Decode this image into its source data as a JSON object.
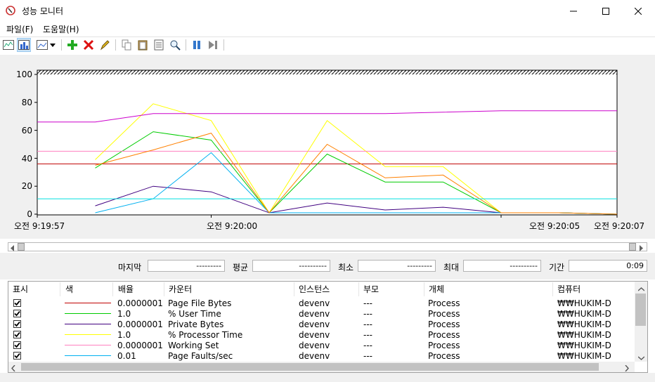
{
  "window": {
    "title": "성능 모니터"
  },
  "menu": [
    "파일(F)",
    "도움말(H)"
  ],
  "toolbar": {
    "icons": [
      "view-graph-icon",
      "view-histogram-icon",
      "view-report-icon",
      "dropdown-arrow-icon",
      "add-counter-icon",
      "delete-counter-icon",
      "highlight-icon",
      "copy-properties-icon",
      "paste-counter-list-icon",
      "properties-icon",
      "zoom-icon",
      "freeze-display-icon",
      "update-data-icon"
    ]
  },
  "chart_data": {
    "type": "line",
    "y_ticks": [
      "100",
      "80",
      "60",
      "40",
      "20",
      "0"
    ],
    "ylim": [
      0,
      100
    ],
    "x_labels": [
      "오전 9:19:57",
      "오전 9:20:00",
      "오전 9:20:05",
      "오전 9:20:07"
    ],
    "x_range_seconds": [
      0,
      10
    ],
    "series": [
      {
        "name": "Page File Bytes",
        "color": "#c00000",
        "x": [
          0,
          10
        ],
        "values": [
          36,
          36
        ]
      },
      {
        "name": "% User Time",
        "color": "#00cc00",
        "x": [
          1,
          2,
          3,
          4,
          5,
          6,
          7,
          8,
          9,
          10
        ],
        "values": [
          33,
          59,
          53,
          1,
          43,
          23,
          23,
          1,
          1,
          0
        ]
      },
      {
        "name": "Private Bytes",
        "color": "#400080",
        "x": [
          1,
          2,
          3,
          4,
          5,
          6,
          7,
          8,
          9,
          10
        ],
        "values": [
          6,
          20,
          16,
          1,
          8,
          3,
          5,
          1,
          1,
          0
        ]
      },
      {
        "name": "% Processor Time",
        "color": "#ffff00",
        "x": [
          1,
          2,
          3,
          4,
          5,
          6,
          7,
          8,
          9,
          10
        ],
        "values": [
          39,
          79,
          67,
          1,
          67,
          34,
          34,
          1,
          1,
          0
        ]
      },
      {
        "name": "Working Set",
        "color": "#ff80c0",
        "x": [
          0,
          10
        ],
        "values": [
          45,
          45
        ]
      },
      {
        "name": "Page Faults/sec",
        "color": "#00b0f0",
        "x": [
          1,
          2,
          3,
          4,
          5,
          6,
          7,
          8,
          9,
          10
        ],
        "values": [
          1,
          11,
          44,
          1,
          1,
          1,
          1,
          1,
          1,
          0
        ]
      },
      {
        "name": "",
        "color": "#ff8000",
        "x": [
          1,
          2,
          3,
          4,
          5,
          6,
          7,
          8,
          9,
          10
        ],
        "values": [
          35,
          46,
          58,
          1,
          50,
          26,
          28,
          1,
          1,
          0
        ]
      },
      {
        "name": "",
        "color": "#cc00cc",
        "x": [
          0,
          1,
          2,
          3,
          4,
          5,
          6,
          7,
          8,
          9,
          10
        ],
        "values": [
          66,
          66,
          72,
          72,
          72,
          72,
          72,
          73,
          74,
          74,
          74
        ]
      },
      {
        "name": "",
        "color": "#00e0e0",
        "x": [
          0,
          10
        ],
        "values": [
          11,
          11
        ]
      }
    ]
  },
  "stats": {
    "last_label": "마지막",
    "last_value": "---------",
    "avg_label": "평균",
    "avg_value": "----------",
    "min_label": "최소",
    "min_value": "---------",
    "max_label": "최대",
    "max_value": "----------",
    "duration_label": "기간",
    "duration_value": "0:09"
  },
  "legend": {
    "columns": [
      "표시",
      "색",
      "배율",
      "카운터",
      "인스턴스",
      "부모",
      "개체",
      "컴퓨터"
    ],
    "rows": [
      {
        "show": true,
        "color": "#c00000",
        "scale": "0.0000001",
        "counter": "Page File Bytes",
        "instance": "devenv",
        "parent": "---",
        "object": "Process",
        "computer": "₩₩HUKIM-D"
      },
      {
        "show": true,
        "color": "#00cc00",
        "scale": "1.0",
        "counter": "% User Time",
        "instance": "devenv",
        "parent": "---",
        "object": "Process",
        "computer": "₩₩HUKIM-D"
      },
      {
        "show": true,
        "color": "#400080",
        "scale": "0.0000001",
        "counter": "Private Bytes",
        "instance": "devenv",
        "parent": "---",
        "object": "Process",
        "computer": "₩₩HUKIM-D"
      },
      {
        "show": true,
        "color": "#ffff00",
        "scale": "1.0",
        "counter": "% Processor Time",
        "instance": "devenv",
        "parent": "---",
        "object": "Process",
        "computer": "₩₩HUKIM-D"
      },
      {
        "show": true,
        "color": "#ff80c0",
        "scale": "0.0000001",
        "counter": "Working Set",
        "instance": "devenv",
        "parent": "---",
        "object": "Process",
        "computer": "₩₩HUKIM-D"
      },
      {
        "show": true,
        "color": "#00b0f0",
        "scale": "0.01",
        "counter": "Page Faults/sec",
        "instance": "devenv",
        "parent": "---",
        "object": "Process",
        "computer": "₩₩HUKIM-D"
      }
    ]
  }
}
